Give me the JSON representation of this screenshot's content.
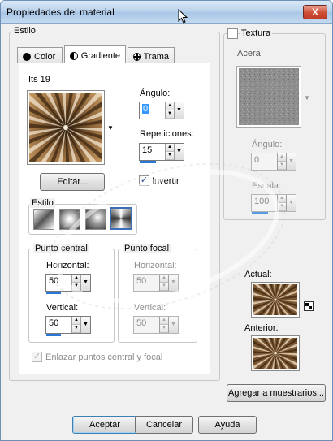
{
  "window": {
    "title": "Propiedades del material",
    "close_label": "X"
  },
  "estilo_group": {
    "label": "Estilo"
  },
  "tabs": [
    {
      "label": "Color",
      "icon": "circle-icon",
      "active": false
    },
    {
      "label": "Gradiente",
      "icon": "half-circle-icon",
      "active": true
    },
    {
      "label": "Trama",
      "icon": "crosshair-icon",
      "active": false
    }
  ],
  "gradient": {
    "name": "Its 19",
    "edit_label": "Editar...",
    "angle_label": "Ángulo:",
    "angle_value": "0",
    "repetitions_label": "Repeticiones:",
    "repetitions_value": "15",
    "invert_label": "Invertir",
    "invert_checked": "✓",
    "style_label": "Estilo",
    "center_label": "Punto central",
    "center_h_label": "Horizontal:",
    "center_h_value": "50",
    "center_v_label": "Vertical:",
    "center_v_value": "50",
    "focal_label": "Punto focal",
    "focal_h_label": "Horizontal:",
    "focal_h_value": "50",
    "focal_v_label": "Vertical:",
    "focal_v_value": "50",
    "link_label": "Enlazar puntos central y focal",
    "link_checked": "✓"
  },
  "texture": {
    "label": "Textura",
    "name": "Acera",
    "angle_label": "Ángulo:",
    "angle_value": "0",
    "scale_label": "Escala:",
    "scale_value": "100"
  },
  "preview": {
    "current_label": "Actual:",
    "previous_label": "Anterior:",
    "add_swatch_label": "Agregar a muestrarios..."
  },
  "buttons": {
    "ok": "Aceptar",
    "cancel": "Cancelar",
    "help": "Ayuda"
  },
  "colors": {
    "gradient_dark": "#3b2510",
    "gradient_light": "#f3e6cf",
    "accent": "#2b77d6"
  }
}
